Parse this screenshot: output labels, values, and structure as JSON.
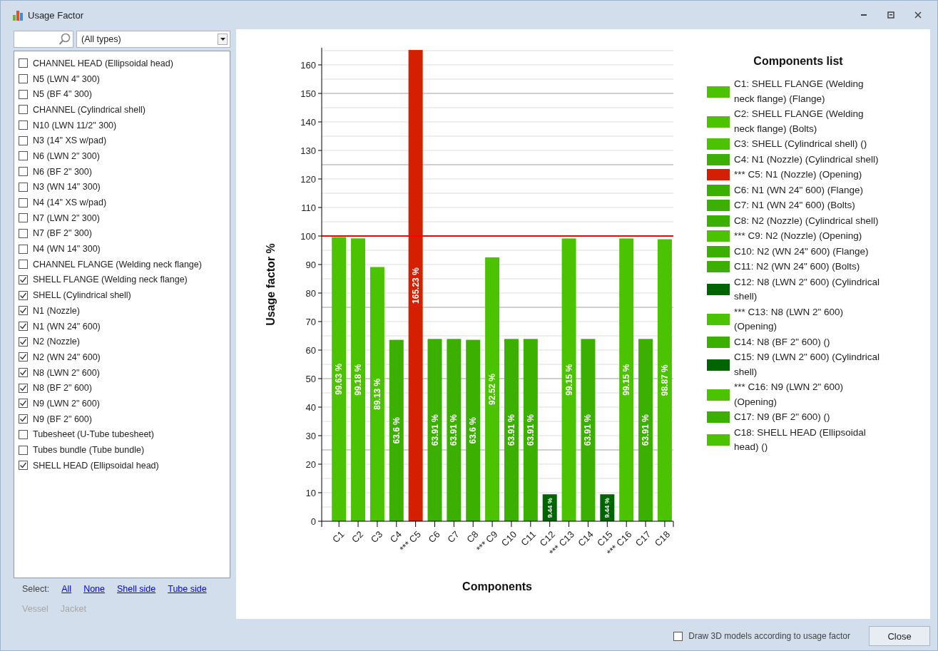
{
  "window": {
    "title": "Usage Factor"
  },
  "filter": {
    "type_dropdown": "(All types)"
  },
  "components": [
    {
      "label": "CHANNEL HEAD (Ellipsoidal head)",
      "checked": false
    },
    {
      "label": "N5 (LWN 4\" 300)",
      "checked": false
    },
    {
      "label": "N5 (BF 4\" 300)",
      "checked": false
    },
    {
      "label": "CHANNEL (Cylindrical shell)",
      "checked": false
    },
    {
      "label": "N10 (LWN 11/2\" 300)",
      "checked": false
    },
    {
      "label": "N3 (14\" XS w/pad)",
      "checked": false
    },
    {
      "label": "N6 (LWN 2\" 300)",
      "checked": false
    },
    {
      "label": "N6 (BF 2\" 300)",
      "checked": false
    },
    {
      "label": "N3 (WN 14\" 300)",
      "checked": false
    },
    {
      "label": "N4 (14\" XS w/pad)",
      "checked": false
    },
    {
      "label": "N7 (LWN 2\" 300)",
      "checked": false
    },
    {
      "label": "N7 (BF 2\" 300)",
      "checked": false
    },
    {
      "label": "N4 (WN 14\" 300)",
      "checked": false
    },
    {
      "label": "CHANNEL FLANGE (Welding neck flange)",
      "checked": false
    },
    {
      "label": "SHELL FLANGE (Welding neck flange)",
      "checked": true
    },
    {
      "label": "SHELL (Cylindrical shell)",
      "checked": true
    },
    {
      "label": "N1 (Nozzle)",
      "checked": true
    },
    {
      "label": "N1 (WN 24\" 600)",
      "checked": true
    },
    {
      "label": "N2 (Nozzle)",
      "checked": true
    },
    {
      "label": "N2 (WN 24\" 600)",
      "checked": true
    },
    {
      "label": "N8 (LWN 2\" 600)",
      "checked": true
    },
    {
      "label": "N8 (BF 2\" 600)",
      "checked": true
    },
    {
      "label": "N9 (LWN 2\" 600)",
      "checked": true
    },
    {
      "label": "N9 (BF 2\" 600)",
      "checked": true
    },
    {
      "label": "Tubesheet (U-Tube tubesheet)",
      "checked": false
    },
    {
      "label": "Tubes bundle (Tube bundle)",
      "checked": false
    },
    {
      "label": "SHELL HEAD (Ellipsoidal head)",
      "checked": true
    }
  ],
  "select": {
    "label": "Select:",
    "links": [
      {
        "label": "All",
        "disabled": false
      },
      {
        "label": "None",
        "disabled": false
      },
      {
        "label": "Shell side",
        "disabled": false
      },
      {
        "label": "Tube side",
        "disabled": false
      },
      {
        "label": "Vessel",
        "disabled": true
      },
      {
        "label": "Jacket",
        "disabled": true
      }
    ]
  },
  "chart": {
    "chart_data": {
      "type": "bar",
      "xlabel": "Components",
      "ylabel": "Usage factor %",
      "categories": [
        "C1",
        "C2",
        "C3",
        "C4",
        "*** C5",
        "C6",
        "C7",
        "C8",
        "*** C9",
        "C10",
        "C11",
        "C12",
        "*** C13",
        "C14",
        "C15",
        "*** C16",
        "C17",
        "C18"
      ],
      "series": [
        {
          "colors": [
            "#4cc300",
            "#4cc300",
            "#4cc300",
            "#3cb000",
            "#d42000",
            "#3cb000",
            "#3cb000",
            "#3cb000",
            "#4cc300",
            "#3cb000",
            "#3cb000",
            "#006400",
            "#4cc300",
            "#3cb000",
            "#006400",
            "#4cc300",
            "#3cb000",
            "#4cc300"
          ],
          "values": [
            99.63,
            99.18,
            89.13,
            63.6,
            165.23,
            63.91,
            63.91,
            63.6,
            92.52,
            63.91,
            63.91,
            9.44,
            99.15,
            63.91,
            9.44,
            99.15,
            63.91,
            98.87
          ]
        }
      ],
      "ylim": [
        0,
        166
      ],
      "grid": true,
      "yticks": [
        0,
        10,
        20,
        30,
        40,
        50,
        60,
        70,
        80,
        90,
        100,
        110,
        120,
        130,
        140,
        150,
        160
      ],
      "value_labels": [
        "99.63 %",
        "99.18 %",
        "89.13 %",
        "63.6 %",
        "165.23 %",
        "63.91 %",
        "63.91 %",
        "63.6 %",
        "92.52 %",
        "63.91 %",
        "63.91 %",
        "9.44 %",
        "99.15 %",
        "63.91 %",
        "9.44 %",
        "99.15 %",
        "63.91 %",
        "98.87 %"
      ],
      "ref_lines": [
        {
          "axis": "y",
          "value": 100,
          "color": "#ff0000"
        }
      ]
    },
    "legend_title": "Components list",
    "legend": [
      {
        "label": "C1: SHELL FLANGE (Welding neck flange) (Flange)",
        "color": "#4cc300"
      },
      {
        "label": "C2: SHELL FLANGE (Welding neck flange) (Bolts)",
        "color": "#4cc300"
      },
      {
        "label": "C3: SHELL (Cylindrical shell) ()",
        "color": "#4cc300"
      },
      {
        "label": "C4: N1 (Nozzle) (Cylindrical shell)",
        "color": "#3cb000"
      },
      {
        "label": "*** C5: N1 (Nozzle) (Opening)",
        "color": "#d42000"
      },
      {
        "label": "C6: N1 (WN 24\" 600) (Flange)",
        "color": "#3cb000"
      },
      {
        "label": "C7: N1 (WN 24\" 600) (Bolts)",
        "color": "#3cb000"
      },
      {
        "label": "C8: N2 (Nozzle) (Cylindrical shell)",
        "color": "#3cb000"
      },
      {
        "label": "*** C9: N2 (Nozzle) (Opening)",
        "color": "#4cc300"
      },
      {
        "label": "C10: N2 (WN 24\" 600) (Flange)",
        "color": "#3cb000"
      },
      {
        "label": "C11: N2 (WN 24\" 600) (Bolts)",
        "color": "#3cb000"
      },
      {
        "label": "C12: N8 (LWN 2\" 600) (Cylindrical shell)",
        "color": "#006400"
      },
      {
        "label": "*** C13: N8 (LWN 2\" 600) (Opening)",
        "color": "#4cc300"
      },
      {
        "label": "C14: N8 (BF 2\" 600) ()",
        "color": "#3cb000"
      },
      {
        "label": "C15: N9 (LWN 2\" 600) (Cylindrical shell)",
        "color": "#006400"
      },
      {
        "label": "*** C16: N9 (LWN 2\" 600) (Opening)",
        "color": "#4cc300"
      },
      {
        "label": "C17: N9 (BF 2\" 600) ()",
        "color": "#3cb000"
      },
      {
        "label": "C18: SHELL HEAD (Ellipsoidal head) ()",
        "color": "#4cc300"
      }
    ]
  },
  "footer": {
    "draw_3d": {
      "label": "Draw 3D models according to usage factor",
      "checked": false
    },
    "close_button": "Close"
  }
}
